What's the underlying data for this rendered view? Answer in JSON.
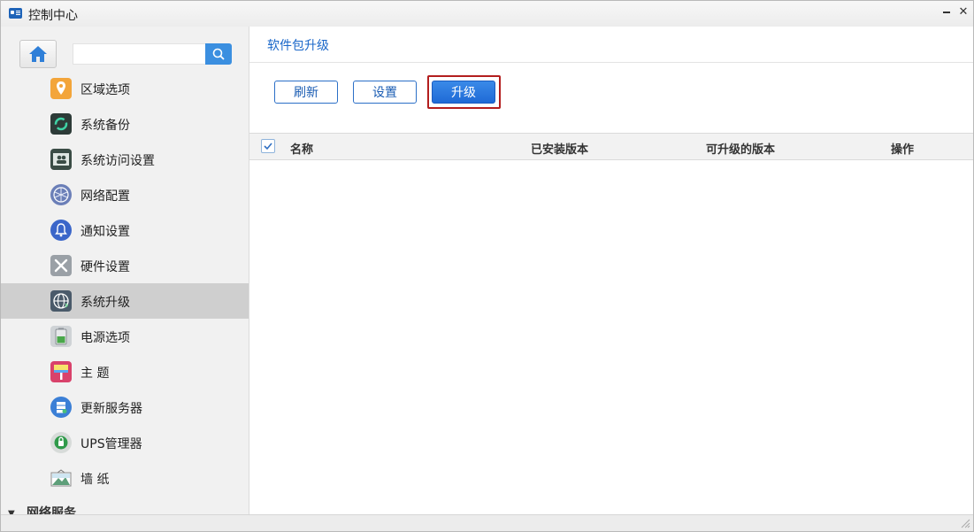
{
  "window": {
    "title": "控制中心"
  },
  "sidebar": {
    "search": {
      "value": "",
      "placeholder": ""
    },
    "items": [
      {
        "label": "区域选项",
        "icon": "location-pin-icon",
        "color": "#f3a53a"
      },
      {
        "label": "系统备份",
        "icon": "backup-icon",
        "color": "#2a7f66"
      },
      {
        "label": "系统访问设置",
        "icon": "users-icon",
        "color": "#3a4c45"
      },
      {
        "label": "网络配置",
        "icon": "network-globe-icon",
        "color": "#6b7fb8"
      },
      {
        "label": "通知设置",
        "icon": "bell-icon",
        "color": "#3b66c9"
      },
      {
        "label": "硬件设置",
        "icon": "tools-icon",
        "color": "#9aa0a6"
      },
      {
        "label": "系统升级",
        "icon": "globe-upgrade-icon",
        "color": "#4a5a6a"
      },
      {
        "label": "电源选项",
        "icon": "battery-icon",
        "color": "#49a84a"
      },
      {
        "label": "主 题",
        "icon": "paint-roller-icon",
        "color": "#d9426b"
      },
      {
        "label": "更新服务器",
        "icon": "server-icon",
        "color": "#3b7fd6"
      },
      {
        "label": "UPS管理器",
        "icon": "ups-icon",
        "color": "#2f9a4a"
      },
      {
        "label": "墙 纸",
        "icon": "wallpaper-icon",
        "color": "#5e9f7a"
      }
    ],
    "active_index": 6,
    "section": {
      "label": "网络服务"
    }
  },
  "main": {
    "title": "软件包升级",
    "buttons": {
      "refresh": "刷新",
      "settings": "设置",
      "upgrade": "升级"
    },
    "table": {
      "columns": [
        "名称",
        "已安装版本",
        "可升级的版本",
        "操作"
      ],
      "rows": []
    }
  },
  "colors": {
    "accent": "#1a67c9",
    "button_primary": "#2a78e0",
    "highlight_ring": "#b31e1e"
  }
}
